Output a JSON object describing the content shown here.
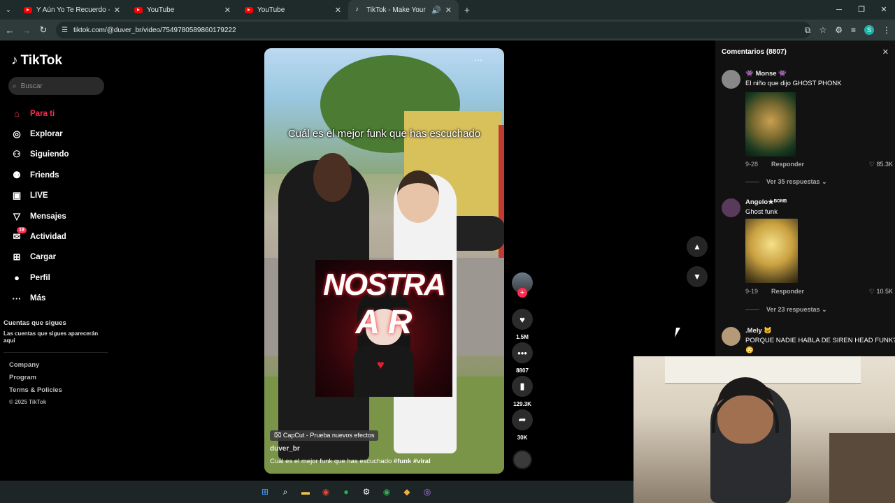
{
  "browser": {
    "tabs": [
      {
        "label": "Y Aún Yo Te Recuerdo - YouTube",
        "icon": "youtube-icon",
        "active": false
      },
      {
        "label": "YouTube",
        "icon": "youtube-icon",
        "active": false
      },
      {
        "label": "YouTube",
        "icon": "youtube-icon",
        "active": false
      },
      {
        "label": "TikTok - Make Your Day",
        "icon": "tiktok-icon",
        "active": true
      }
    ],
    "url": "tiktok.com/@duver_br/video/7549780589860179222",
    "profile_initial": "S"
  },
  "sidebar": {
    "logo": "TikTok",
    "search_placeholder": "Buscar",
    "items": [
      {
        "label": "Para ti",
        "icon": "home-icon",
        "active": true
      },
      {
        "label": "Explorar",
        "icon": "compass-icon"
      },
      {
        "label": "Siguiendo",
        "icon": "following-icon"
      },
      {
        "label": "Friends",
        "icon": "friends-icon"
      },
      {
        "label": "LIVE",
        "icon": "live-icon"
      },
      {
        "label": "Mensajes",
        "icon": "messages-icon"
      },
      {
        "label": "Actividad",
        "icon": "activity-icon",
        "badge": "19"
      },
      {
        "label": "Cargar",
        "icon": "upload-icon"
      },
      {
        "label": "Perfil",
        "icon": "profile-icon"
      },
      {
        "label": "Más",
        "icon": "more-icon"
      }
    ],
    "following_heading": "Cuentas que sigues",
    "following_sub": "Las cuentas que sigues aparecerán aquí",
    "footer": [
      "Company",
      "Program",
      "Terms & Policies"
    ],
    "copyright": "© 2025 TikTok"
  },
  "video": {
    "caption": "Cuál es el mejor funk que has escuchado",
    "effect_label": "CapCut - Prueba nuevos efectos",
    "username": "duver_br",
    "description": "Cuál es el mejor funk que has escuchado",
    "hashtags": "#funk  #viral",
    "album_text_top": "NOSTRA",
    "album_text_bottom": "A R"
  },
  "actions": {
    "likes": "1.5M",
    "comments": "8807",
    "saves": "129.3K",
    "shares": "30K"
  },
  "comments": {
    "header": "Comentarios (8807)",
    "items": [
      {
        "name": "👾 Monse 👾",
        "text": "El niño que dijo GHOST PHONK",
        "date": "9-28",
        "reply": "Responder",
        "likes": "85.3K",
        "more": "Ver 35 respuestas"
      },
      {
        "name": "Angelo★ᴮᴼᴹᴮ",
        "text": "Ghost funk",
        "date": "9-19",
        "reply": "Responder",
        "likes": "10.5K",
        "more": "Ver 23 respuestas"
      },
      {
        "name": ".Mely 🐱",
        "text": "PORQUE NADIE HABLA DE SIREN HEAD FUNK?",
        "emoji": "😳"
      }
    ]
  }
}
